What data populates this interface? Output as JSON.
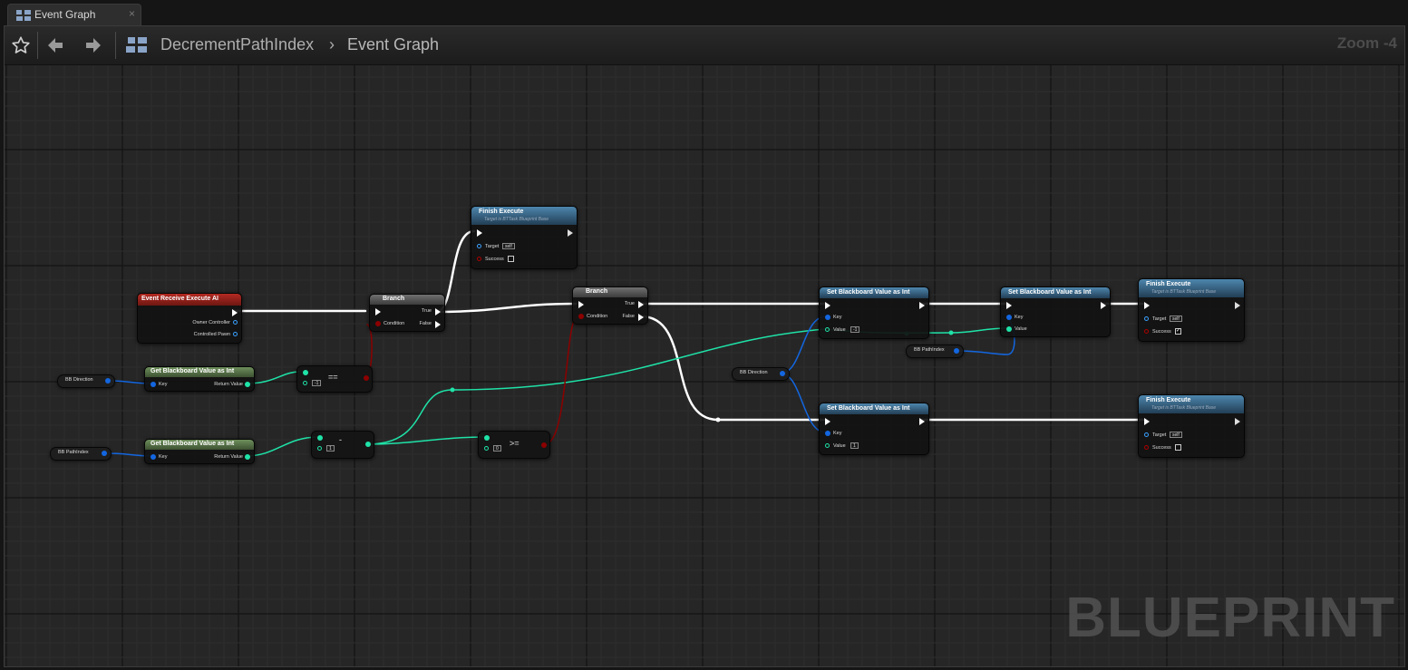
{
  "tab": {
    "title": "Event Graph",
    "close": "×"
  },
  "toolbar": {
    "breadcrumb_root": "DecrementPathIndex",
    "breadcrumb_sep": "›",
    "breadcrumb_leaf": "Event Graph",
    "zoom": "Zoom -4"
  },
  "watermark": "BLUEPRINT",
  "colors": {
    "exec_wire": "#ffffff",
    "int_wire": "#1fe3a8",
    "object_wire": "#1366e0",
    "bool_wire": "#8c0000",
    "event_header": "#a5231c",
    "function_header": "#3f6d8e",
    "pure_header": "#5e7c4e",
    "branch_header": "#5a5a5a"
  },
  "nodes": {
    "event_receive": {
      "title": "Event Receive Execute AI",
      "pin_owner": "Owner Controller",
      "pin_pawn": "Controlled Pawn"
    },
    "get_bb_1": {
      "title": "Get Blackboard Value as Int",
      "pin_key": "Key",
      "pin_return": "Return Value"
    },
    "get_bb_2": {
      "title": "Get Blackboard Value as Int",
      "pin_key": "Key",
      "pin_return": "Return Value"
    },
    "var_dir_1": {
      "name": "BB Direction"
    },
    "var_pathidx_1": {
      "name": "BB PathIndex"
    },
    "var_dir_2": {
      "name": "BB Direction"
    },
    "var_pathidx_2": {
      "name": "BB PathIndex"
    },
    "eq_node": {
      "op": "==",
      "value": "-1"
    },
    "minus_node": {
      "op": "-",
      "value": "1"
    },
    "gte_node": {
      "op": ">=",
      "value": "0"
    },
    "branch_1": {
      "title": "Branch",
      "pin_condition": "Condition",
      "pin_true": "True",
      "pin_false": "False"
    },
    "branch_2": {
      "title": "Branch",
      "pin_condition": "Condition",
      "pin_true": "True",
      "pin_false": "False"
    },
    "finish_1": {
      "title": "Finish Execute",
      "subtitle": "Target is BTTask Blueprint Base",
      "pin_target": "Target",
      "target_val": "self",
      "pin_success": "Success",
      "success_checked": false
    },
    "finish_2": {
      "title": "Finish Execute",
      "subtitle": "Target is BTTask Blueprint Base",
      "pin_target": "Target",
      "target_val": "self",
      "pin_success": "Success",
      "success_checked": true
    },
    "finish_3": {
      "title": "Finish Execute",
      "subtitle": "Target is BTTask Blueprint Base",
      "pin_target": "Target",
      "target_val": "self",
      "pin_success": "Success",
      "success_checked": false
    },
    "set_bb_1": {
      "title": "Set Blackboard Value as Int",
      "pin_key": "Key",
      "pin_value": "Value",
      "value": "-1"
    },
    "set_bb_2": {
      "title": "Set Blackboard Value as Int",
      "pin_key": "Key",
      "pin_value": "Value"
    },
    "set_bb_3": {
      "title": "Set Blackboard Value as Int",
      "pin_key": "Key",
      "pin_value": "Value",
      "value": "1"
    }
  }
}
